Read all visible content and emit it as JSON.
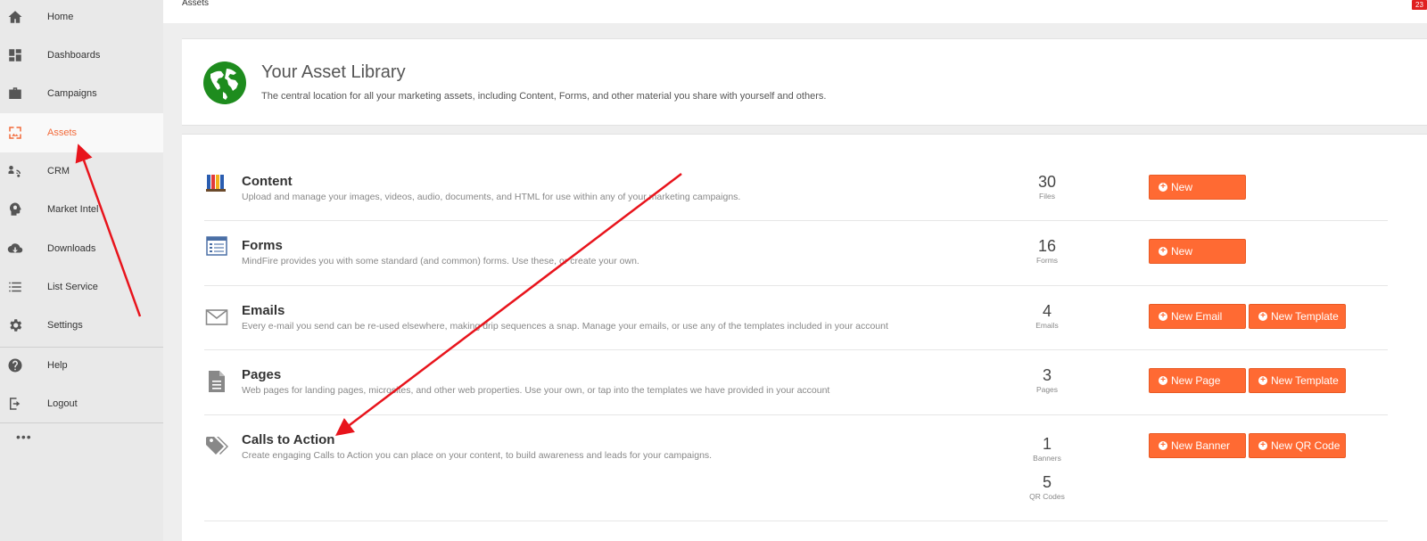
{
  "sidebar": {
    "items": [
      {
        "label": "Home",
        "icon": "home-icon"
      },
      {
        "label": "Dashboards",
        "icon": "dashboard-icon"
      },
      {
        "label": "Campaigns",
        "icon": "briefcase-icon"
      },
      {
        "label": "Assets",
        "icon": "assets-image-icon",
        "active": true
      },
      {
        "label": "CRM",
        "icon": "crm-icon"
      },
      {
        "label": "Market Intel",
        "icon": "lightbulb-head-icon"
      },
      {
        "label": "Downloads",
        "icon": "cloud-download-icon"
      },
      {
        "label": "List Service",
        "icon": "list-icon"
      },
      {
        "label": "Settings",
        "icon": "gear-icon"
      },
      {
        "label": "Help",
        "icon": "help-icon"
      },
      {
        "label": "Logout",
        "icon": "logout-icon"
      }
    ],
    "more": "•••"
  },
  "breadcrumb": "Assets",
  "notification_count": "23",
  "header": {
    "title": "Your Asset Library",
    "subtitle": "The central location for all your marketing assets, including Content, Forms, and other material you share with yourself and others."
  },
  "assets": [
    {
      "title": "Content",
      "description": "Upload and manage your images, videos, audio, documents, and HTML for use within any of your marketing campaigns.",
      "icon": "books-icon",
      "stats": [
        {
          "value": "30",
          "label": "Files"
        }
      ],
      "buttons": [
        "New"
      ]
    },
    {
      "title": "Forms",
      "description": "MindFire provides you with some standard (and common) forms. Use these, or create your own.",
      "icon": "form-icon",
      "stats": [
        {
          "value": "16",
          "label": "Forms"
        }
      ],
      "buttons": [
        "New"
      ]
    },
    {
      "title": "Emails",
      "description": "Every e-mail you send can be re-used elsewhere, making drip sequences a snap. Manage your emails, or use any of the templates included in your account",
      "icon": "envelope-icon",
      "stats": [
        {
          "value": "4",
          "label": "Emails"
        }
      ],
      "buttons": [
        "New Email",
        "New Template"
      ]
    },
    {
      "title": "Pages",
      "description": "Web pages for landing pages, microsites, and other web properties. Use your own, or tap into the templates we have provided in your account",
      "icon": "page-icon",
      "stats": [
        {
          "value": "3",
          "label": "Pages"
        }
      ],
      "buttons": [
        "New Page",
        "New Template"
      ]
    },
    {
      "title": "Calls to Action",
      "description": "Create engaging Calls to Action you can place on your content, to build awareness and leads for your campaigns.",
      "icon": "tags-icon",
      "stats": [
        {
          "value": "1",
          "label": "Banners"
        },
        {
          "value": "5",
          "label": "QR Codes"
        }
      ],
      "buttons": [
        "New Banner",
        "New QR Code"
      ]
    }
  ],
  "colors": {
    "accent": "#ff6a33",
    "active_nav": "#f26a3a",
    "annotation_arrow": "#e8141c",
    "globe": "#1e8c1e"
  }
}
